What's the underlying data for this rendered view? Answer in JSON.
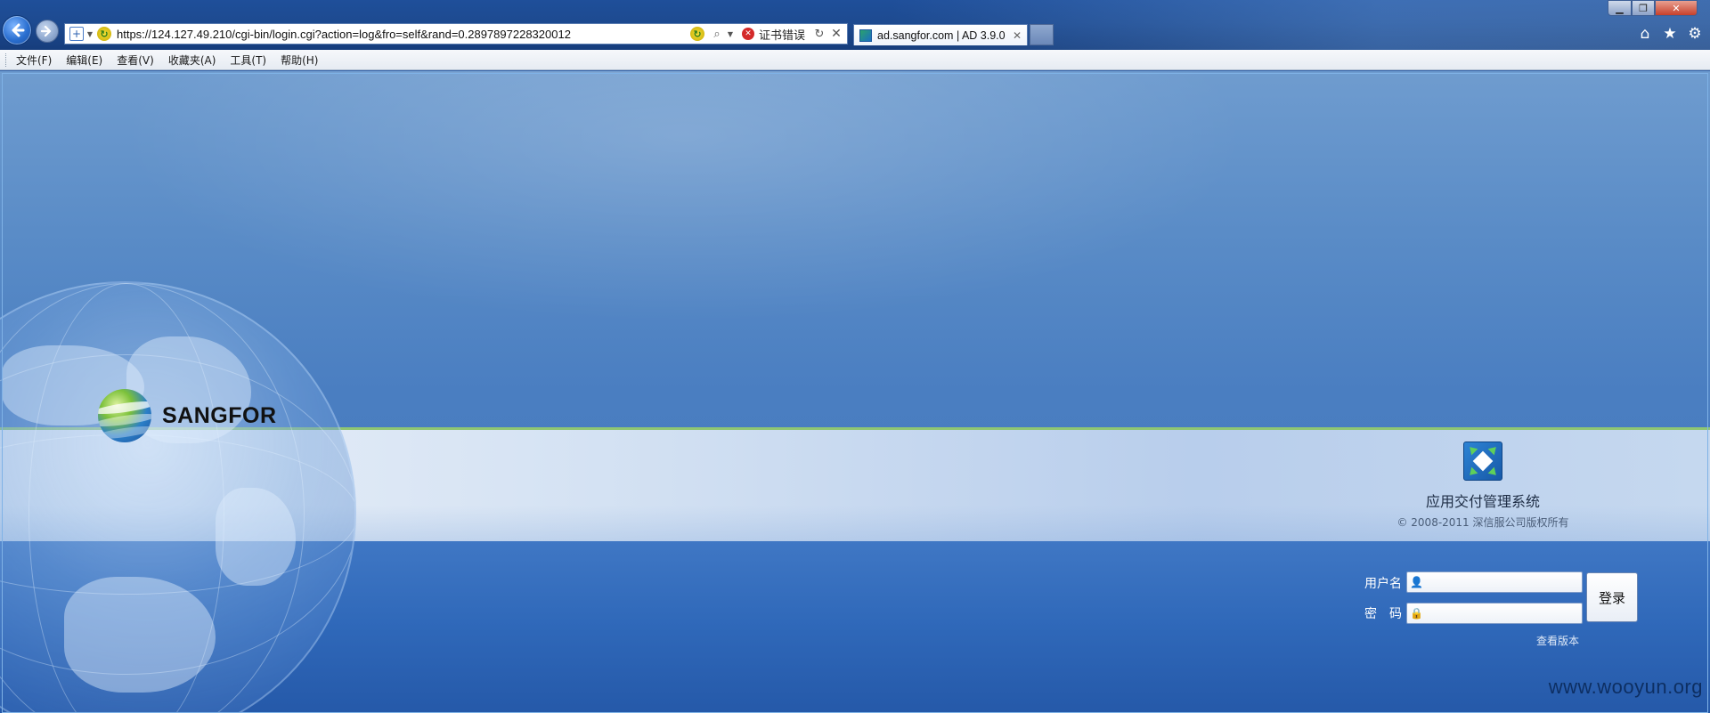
{
  "browser": {
    "address_bar": {
      "url": "https://124.127.49.210/cgi-bin/login.cgi?action=log&fro=self&rand=0.2897897228320012",
      "cert_error_label": "证书错误"
    },
    "tab": {
      "title": "ad.sangfor.com | AD 3.9.0"
    },
    "menu": [
      "文件(F)",
      "编辑(E)",
      "查看(V)",
      "收藏夹(A)",
      "工具(T)",
      "帮助(H)"
    ],
    "icons": {
      "back": "back-arrow-icon",
      "forward": "forward-arrow-icon",
      "home": "home-icon",
      "favorites": "star-icon",
      "tools": "gear-icon"
    }
  },
  "page": {
    "logo_text": "SANGFOR",
    "product_name": "应用交付管理系统",
    "copyright": "© 2008-2011  深信服公司版权所有",
    "login": {
      "username_label": "用户名",
      "password_label": "密　码",
      "username_value": "",
      "password_value": "",
      "submit_label": "登录",
      "view_version_label": "查看版本"
    },
    "watermark": "www.wooyun.org"
  },
  "colors": {
    "page_bg": "#4a7ec1",
    "band_top_line": "#8fc673",
    "titlebar": "#1d4a90"
  }
}
